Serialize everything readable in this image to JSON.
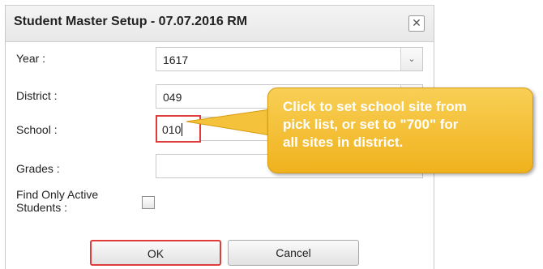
{
  "dialog": {
    "title": "Student Master Setup - 07.07.2016 RM",
    "close_glyph": "✕",
    "close_icon": "close-icon"
  },
  "fields": {
    "year": {
      "label": "Year :",
      "value": "1617"
    },
    "district": {
      "label": "District :",
      "value": "049"
    },
    "school": {
      "label": "School :",
      "value": "010"
    },
    "grades": {
      "label": "Grades :",
      "value": ""
    },
    "find_active": {
      "label_line1": "Find Only Active",
      "label_line2": "Students :",
      "checked": false
    }
  },
  "dropdown_icon": "chevron-down-icon",
  "dropdown_glyph": "⌄",
  "buttons": {
    "ok": "OK",
    "cancel": "Cancel"
  },
  "callout": {
    "line1": "Click to set school site from",
    "line2": "pick list, or set to \"700\" for",
    "line3": "all sites in district."
  },
  "colors": {
    "highlight": "#e03c3c",
    "callout_fill": "#f0b21d",
    "callout_text": "#ffffff"
  }
}
